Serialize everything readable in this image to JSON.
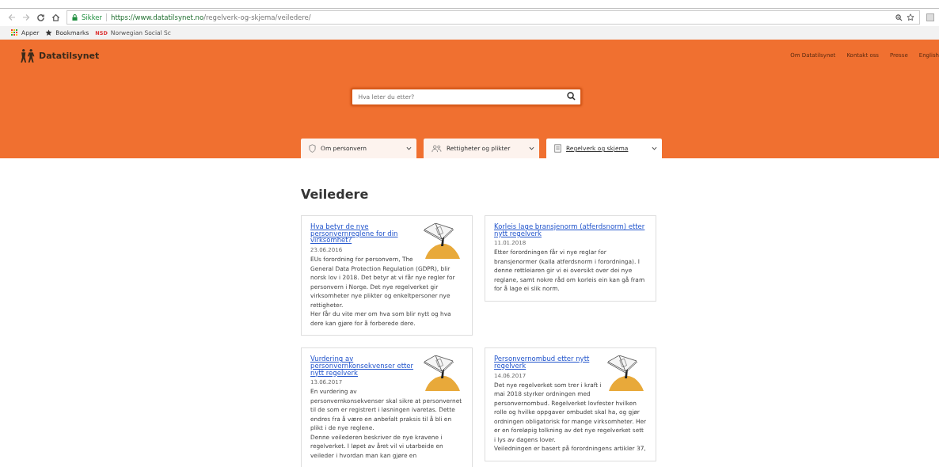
{
  "browser": {
    "secure_label": "Sikker",
    "url_host": "https://www.datatilsynet.no",
    "url_path": "/regelverk-og-skjema/veiledere/",
    "bookmarks": [
      {
        "kind": "apps",
        "label": "Apper"
      },
      {
        "kind": "star",
        "label": "Bookmarks"
      },
      {
        "kind": "nsd",
        "badge": "NSD",
        "label": "Norwegian Social Sc"
      }
    ]
  },
  "header": {
    "logo": "Datatilsynet",
    "links": [
      "Om Datatilsynet",
      "Kontakt oss",
      "Presse",
      "English"
    ],
    "search": {
      "placeholder": "Hva leter du etter?"
    },
    "tabs": [
      {
        "kind": "shield",
        "label": "Om personvern",
        "selected": false
      },
      {
        "kind": "people",
        "label": "Rettigheter og plikter",
        "selected": false
      },
      {
        "kind": "document",
        "label": "Regelverk og skjema",
        "selected": true
      }
    ]
  },
  "heading": "Veiledere",
  "cards": [
    {
      "title": "Hva betyr de nye personvernreglene for din virksomhet?",
      "date": "23.06.2016",
      "image": true,
      "paragraphs": [
        "EUs forordning for personvern, The General Data Protection Regulation (GDPR), blir norsk lov i 2018.  Det betyr at vi får nye regler for personvern i Norge. Det nye regelverket gir virksomheter nye plikter og enkeltpersoner nye rettigheter.",
        "Her får du vite mer om hva som blir nytt og hva dere kan gjøre for å forberede dere."
      ]
    },
    {
      "title": "Korleis lage bransjenorm (atferdsnorm) etter nytt regelverk",
      "date": "11.01.2018",
      "image": false,
      "paragraphs": [
        "Etter forordningen får vi nye reglar for bransjenormer (kalla atferdsnorm i forordninga). I denne rettleiaren gir vi ei oversikt over dei nye reglane, samt nokre råd om korleis ein kan gå fram for å lage ei slik norm."
      ]
    },
    {
      "title": "Vurdering av personvernkonsekvenser etter nytt regelverk",
      "date": "13.06.2017",
      "image": true,
      "paragraphs": [
        "En vurdering av personvernkonsekvenser skal sikre at personvernet til de som er registrert i løsningen ivaretas. Dette endres fra å være en anbefalt praksis til å bli en plikt i de nye reglene.",
        "Denne veilederen beskriver de nye kravene i regelverket. I løpet av året vil vi utarbeide en veileder i hvordan man kan gjøre en"
      ]
    },
    {
      "title": "Personvernombud etter nytt regelverk",
      "date": "14.06.2017",
      "image": true,
      "paragraphs": [
        "Det nye regelverket som trer i kraft i mai 2018 styrker ordningen med personvernombud. Regelverket lovfester hvilken rolle og hvilke oppgaver ombudet skal ha, og gjør ordningen obligatorisk for mange virksomheter. Her er en foreløpig tolkning av det nye regelverket sett i lys av dagens lover.",
        "Veiledningen er basert på forordningens artikler 37,"
      ]
    }
  ]
}
